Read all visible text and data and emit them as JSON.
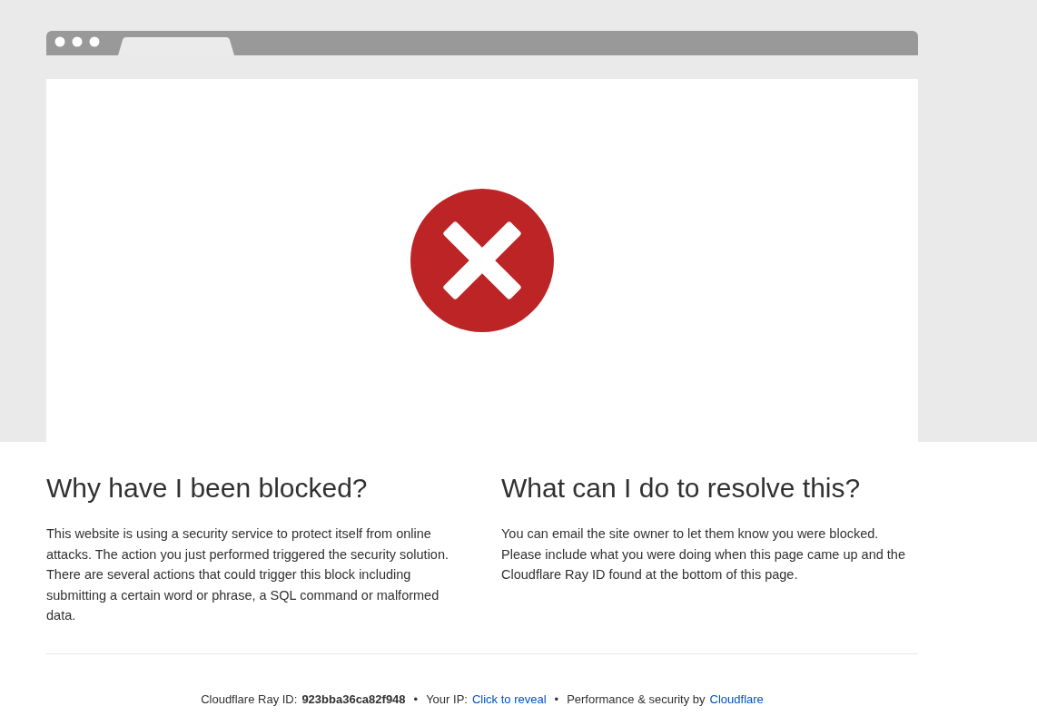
{
  "left": {
    "heading": "Why have I been blocked?",
    "body": "This website is using a security service to protect itself from online attacks. The action you just performed triggered the security solution. There are several actions that could trigger this block including submitting a certain word or phrase, a SQL command or malformed data."
  },
  "right": {
    "heading": "What can I do to resolve this?",
    "body": "You can email the site owner to let them know you were blocked. Please include what you were doing when this page came up and the Cloudflare Ray ID found at the bottom of this page."
  },
  "footer": {
    "ray_label": "Cloudflare Ray ID:",
    "ray_id": "923bba36ca82f948",
    "separators": [
      "•",
      "•"
    ],
    "ip_label": "Your IP:",
    "ip_link": "Click to reveal",
    "perf_label": "Performance & security by",
    "perf_link": "Cloudflare"
  }
}
